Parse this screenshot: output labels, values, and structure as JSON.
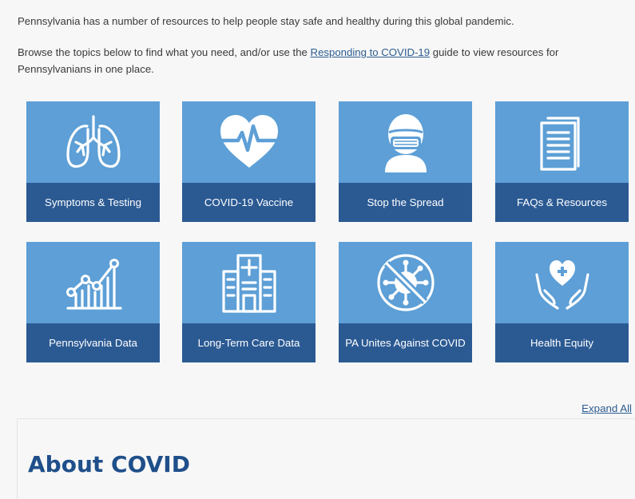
{
  "intro": {
    "line1": "Pennsylvania has a number of resources to help people stay safe and healthy during this global pandemic.",
    "line2_before": "Browse the topics below to find what you need, and/or use the ",
    "line2_link": "Responding to COVID-19",
    "line2_after": " guide to view resources for Pennsylvanians in one place."
  },
  "tiles": [
    {
      "label": "Symptoms & Testing",
      "icon": "lungs-icon"
    },
    {
      "label": "COVID-19 Vaccine",
      "icon": "heartbeat-icon"
    },
    {
      "label": "Stop the Spread",
      "icon": "masked-person-icon"
    },
    {
      "label": "FAQs & Resources",
      "icon": "documents-icon"
    },
    {
      "label": "Pennsylvania Data",
      "icon": "chart-icon"
    },
    {
      "label": "Long-Term Care Data",
      "icon": "hospital-icon"
    },
    {
      "label": "PA Unites Against COVID",
      "icon": "no-virus-icon"
    },
    {
      "label": "Health Equity",
      "icon": "hands-heart-icon"
    }
  ],
  "expand_all": "Expand All",
  "section_title": "About COVID",
  "colors": {
    "tile_top": "#5d9fd6",
    "tile_bottom": "#2b5a93",
    "heading": "#1f4f8a",
    "link": "#2c5d8f"
  }
}
